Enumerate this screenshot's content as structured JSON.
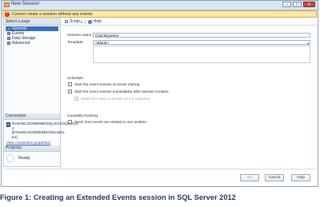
{
  "window": {
    "title": "New Session",
    "minimize": "–",
    "maximize": "□",
    "close": "✕"
  },
  "error": {
    "icon": "error-icon",
    "text": "Cannot create a session without any events."
  },
  "sidebar": {
    "pages_header": "Select a page",
    "pages": [
      {
        "label": "General",
        "selected": true
      },
      {
        "label": "Events",
        "selected": false
      },
      {
        "label": "Data Storage",
        "selected": false
      },
      {
        "label": "Advanced",
        "selected": false
      }
    ],
    "connection_header": "Connection",
    "connection_lines": [
      "RHSHELDONDEBB\\SQL2012\\SQL2012",
      "2",
      "[RHSHELDONDEBB\\Administra",
      "tor]"
    ],
    "connection_link": "View connection properties",
    "progress_header": "Progress",
    "progress_status": "Ready"
  },
  "toolbar": {
    "script_label": "Script",
    "script_arrow": "▾",
    "help_label": "Help",
    "help_glyph": "?"
  },
  "form": {
    "session_name_label": "Session name:",
    "session_name_value": "CheckQueries",
    "template_label": "Template:",
    "template_value": "<Blank>",
    "template_arrow": "▾",
    "schedule_label": "Schedule:",
    "start_server_label": "Start the event session at server startup.",
    "start_now_label": "Start the event session immediately after session creation.",
    "watch_live_label": "Watch live data on screen as it is captured.",
    "causality_label": "Causality tracking:",
    "track_label": "Track how events are related to one another."
  },
  "buttons": {
    "ok": "OK",
    "cancel": "Cancel",
    "help": "Help"
  },
  "caption": "Figure 1: Creating an Extended Events session in SQL Server 2012"
}
